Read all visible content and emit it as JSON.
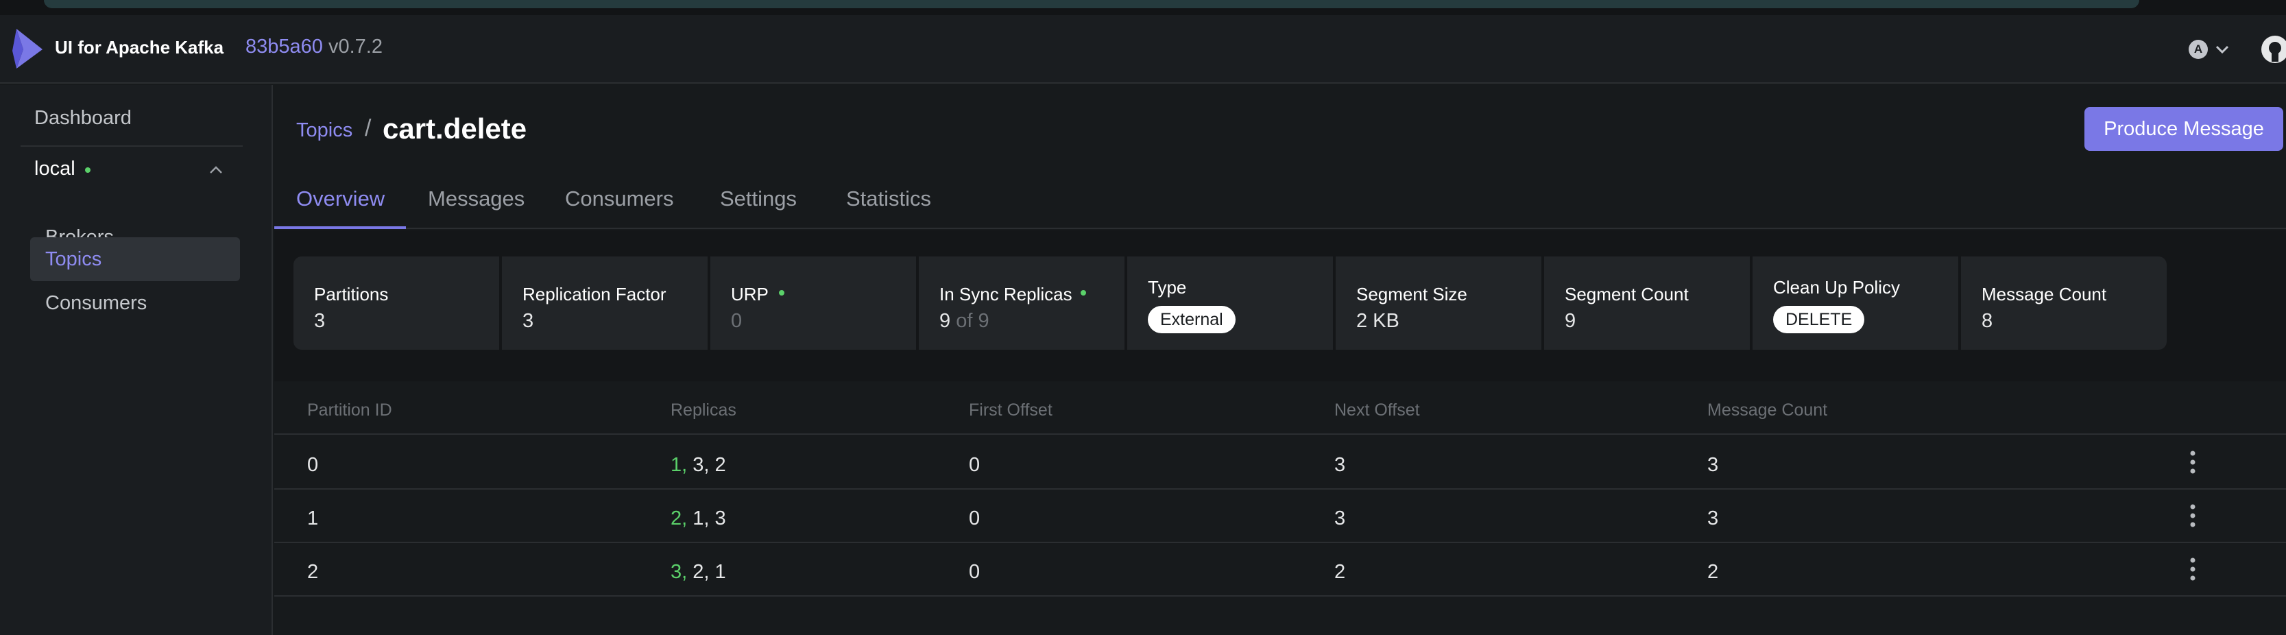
{
  "header": {
    "brand": "UI for Apache Kafka",
    "version_hash": "83b5a60",
    "version": "v0.7.2",
    "avatar_letter": "A"
  },
  "sidebar": {
    "dashboard": "Dashboard",
    "cluster": "local",
    "items": [
      "Brokers",
      "Topics",
      "Consumers"
    ]
  },
  "breadcrumb": {
    "parent": "Topics",
    "separator": "/",
    "current": "cart.delete"
  },
  "produce_button": "Produce Message",
  "tabs": [
    "Overview",
    "Messages",
    "Consumers",
    "Settings",
    "Statistics"
  ],
  "stats": {
    "partitions": {
      "label": "Partitions",
      "value": "3"
    },
    "replication": {
      "label": "Replication Factor",
      "value": "3"
    },
    "urp": {
      "label": "URP",
      "value": "0"
    },
    "isr": {
      "label": "In Sync Replicas",
      "value": "9",
      "of": "of 9"
    },
    "type": {
      "label": "Type",
      "value": "External"
    },
    "segment_size": {
      "label": "Segment Size",
      "value": "2 KB"
    },
    "segment_count": {
      "label": "Segment Count",
      "value": "9"
    },
    "cleanup": {
      "label": "Clean Up Policy",
      "value": "DELETE"
    },
    "message_count": {
      "label": "Message Count",
      "value": "8"
    }
  },
  "table": {
    "headers": [
      "Partition ID",
      "Replicas",
      "First Offset",
      "Next Offset",
      "Message Count"
    ],
    "rows": [
      {
        "partition": "0",
        "leader": "1,",
        "replicas": "3, 2",
        "first": "0",
        "next": "3",
        "count": "3"
      },
      {
        "partition": "1",
        "leader": "2,",
        "replicas": "1, 3",
        "first": "0",
        "next": "3",
        "count": "3"
      },
      {
        "partition": "2",
        "leader": "3,",
        "replicas": "2, 1",
        "first": "0",
        "next": "2",
        "count": "2"
      }
    ]
  },
  "colors": {
    "accent": "#7a78e6",
    "leader_green": "#5bd16a",
    "background": "#171a1c"
  }
}
